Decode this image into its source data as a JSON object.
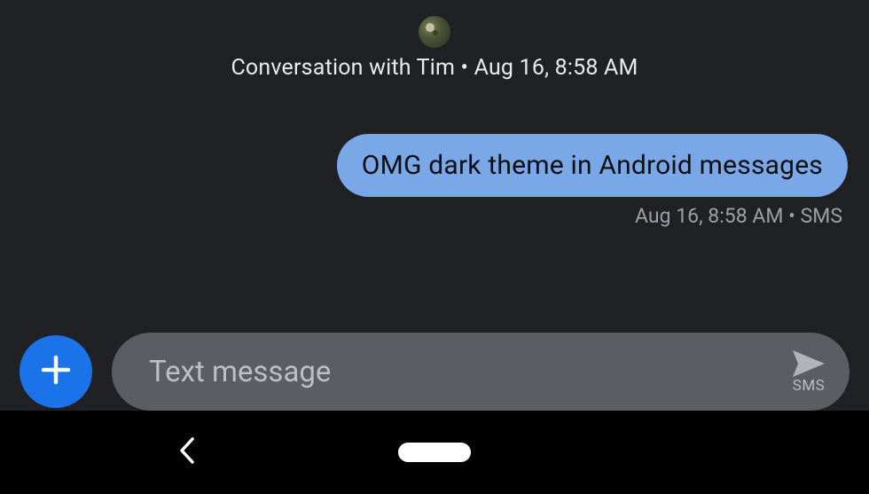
{
  "header": {
    "contact_name": "Tim",
    "label": "Conversation with Tim • Aug 16, 8:58 AM"
  },
  "messages": [
    {
      "text": "OMG dark theme in Android messages",
      "meta": "Aug 16, 8:58 AM • SMS",
      "outgoing": true
    }
  ],
  "compose": {
    "placeholder": "Text message",
    "value": "",
    "send_label": "SMS"
  },
  "icons": {
    "add": "plus-icon",
    "send": "send-icon",
    "back": "chevron-left-icon",
    "home": "home-pill-icon"
  }
}
